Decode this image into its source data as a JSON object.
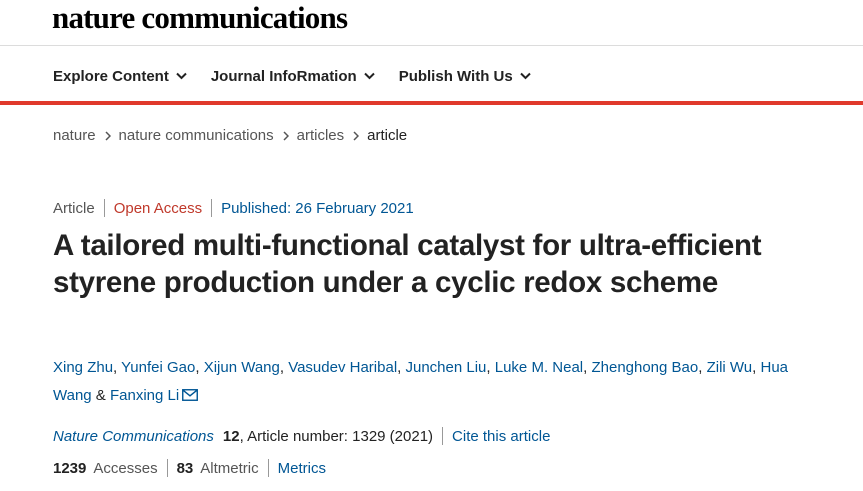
{
  "header": {
    "logo": "nature communications",
    "nav": [
      {
        "label": "Explore Content"
      },
      {
        "label": "Journal InfoRmation"
      },
      {
        "label": "Publish With Us"
      }
    ],
    "accent_color": "#e0392b"
  },
  "breadcrumb": [
    "nature",
    "nature communications",
    "articles",
    "article"
  ],
  "article": {
    "type": "Article",
    "access": "Open Access",
    "published": "Published: 26 February 2021",
    "title": "A tailored multi-functional catalyst for ultra-efficient styrene production under a cyclic redox scheme",
    "authors": [
      "Xing Zhu",
      "Yunfei Gao",
      "Xijun Wang",
      "Vasudev Haribal",
      "Junchen Liu",
      "Luke M. Neal",
      "Zhenghong Bao",
      "Zili Wu",
      "Hua Wang",
      "Fanxing Li"
    ],
    "author_separator": ",",
    "author_last_separator": "&",
    "journal": "Nature Communications",
    "volume": "12",
    "article_number": ", Article number: 1329 (2021)",
    "cite_link": "Cite this article"
  },
  "metrics": {
    "accesses_value": "1239",
    "accesses_label": "Accesses",
    "altmetric_value": "83",
    "altmetric_label": "Altmetric",
    "metrics_link": "Metrics"
  },
  "icons": [
    "chevron-down-icon",
    "chevron-right-icon",
    "envelope-icon"
  ],
  "colors": {
    "link": "#005694",
    "open_access": "#c0392b"
  }
}
